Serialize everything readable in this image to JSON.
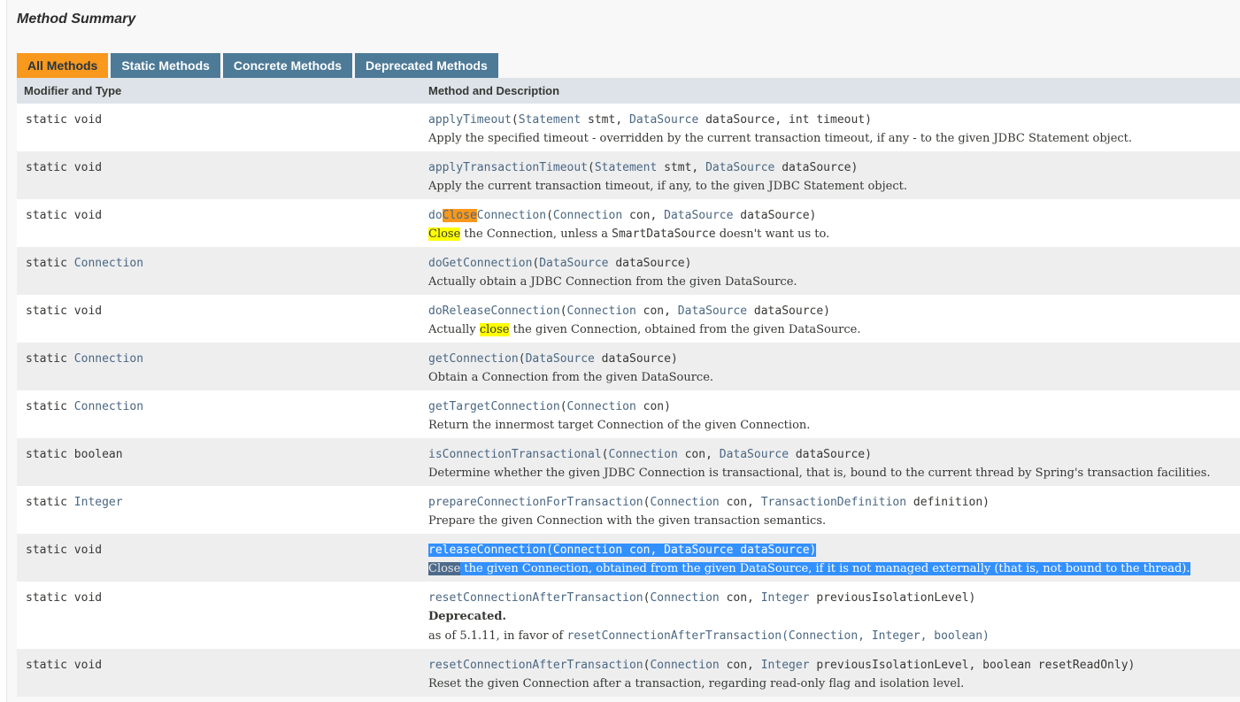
{
  "title": "Method Summary",
  "tabs": [
    "All Methods",
    "Static Methods",
    "Concrete Methods",
    "Deprecated Methods"
  ],
  "header": {
    "col1": "Modifier and Type",
    "col2": "Method and Description"
  },
  "rows": [
    {
      "mod": [
        [
          "static void",
          "p"
        ]
      ],
      "sig": [
        [
          "applyTimeout",
          "l"
        ],
        [
          "(",
          "p"
        ],
        [
          "Statement",
          "l"
        ],
        [
          " stmt, ",
          "p"
        ],
        [
          "DataSource",
          "l"
        ],
        [
          " dataSource, int timeout)",
          "p"
        ]
      ],
      "desc": [
        [
          "Apply the specified timeout - overridden by the current transaction timeout, if any - to the given JDBC Statement object.",
          "p"
        ]
      ]
    },
    {
      "mod": [
        [
          "static void",
          "p"
        ]
      ],
      "sig": [
        [
          "applyTransactionTimeout",
          "l"
        ],
        [
          "(",
          "p"
        ],
        [
          "Statement",
          "l"
        ],
        [
          " stmt, ",
          "p"
        ],
        [
          "DataSource",
          "l"
        ],
        [
          " dataSource)",
          "p"
        ]
      ],
      "desc": [
        [
          "Apply the current transaction timeout, if any, to the given JDBC Statement object.",
          "p"
        ]
      ]
    },
    {
      "mod": [
        [
          "static void",
          "p"
        ]
      ],
      "sig": [
        [
          "do",
          "l"
        ],
        [
          "Close",
          "o"
        ],
        [
          "Connection",
          "l"
        ],
        [
          "(",
          "p"
        ],
        [
          "Connection",
          "l"
        ],
        [
          " con, ",
          "p"
        ],
        [
          "DataSource",
          "l"
        ],
        [
          " dataSource)",
          "p"
        ]
      ],
      "desc": [
        [
          "Close",
          "y"
        ],
        [
          " the Connection, unless a ",
          "p"
        ],
        [
          "SmartDataSource",
          "m"
        ],
        [
          " doesn't want us to.",
          "p"
        ]
      ]
    },
    {
      "mod": [
        [
          "static ",
          "p"
        ],
        [
          "Connection",
          "l"
        ]
      ],
      "sig": [
        [
          "doGetConnection",
          "l"
        ],
        [
          "(",
          "p"
        ],
        [
          "DataSource",
          "l"
        ],
        [
          " dataSource)",
          "p"
        ]
      ],
      "desc": [
        [
          "Actually obtain a JDBC Connection from the given DataSource.",
          "p"
        ]
      ]
    },
    {
      "mod": [
        [
          "static void",
          "p"
        ]
      ],
      "sig": [
        [
          "doReleaseConnection",
          "l"
        ],
        [
          "(",
          "p"
        ],
        [
          "Connection",
          "l"
        ],
        [
          " con, ",
          "p"
        ],
        [
          "DataSource",
          "l"
        ],
        [
          " dataSource)",
          "p"
        ]
      ],
      "desc": [
        [
          "Actually ",
          "p"
        ],
        [
          "close",
          "y"
        ],
        [
          " the given Connection, obtained from the given DataSource.",
          "p"
        ]
      ]
    },
    {
      "mod": [
        [
          "static ",
          "p"
        ],
        [
          "Connection",
          "l"
        ]
      ],
      "sig": [
        [
          "getConnection",
          "l"
        ],
        [
          "(",
          "p"
        ],
        [
          "DataSource",
          "l"
        ],
        [
          " dataSource)",
          "p"
        ]
      ],
      "desc": [
        [
          "Obtain a Connection from the given DataSource.",
          "p"
        ]
      ]
    },
    {
      "mod": [
        [
          "static ",
          "p"
        ],
        [
          "Connection",
          "l"
        ]
      ],
      "sig": [
        [
          "getTargetConnection",
          "l"
        ],
        [
          "(",
          "p"
        ],
        [
          "Connection",
          "l"
        ],
        [
          " con)",
          "p"
        ]
      ],
      "desc": [
        [
          "Return the innermost target Connection of the given Connection.",
          "p"
        ]
      ]
    },
    {
      "mod": [
        [
          "static boolean",
          "p"
        ]
      ],
      "sig": [
        [
          "isConnectionTransactional",
          "l"
        ],
        [
          "(",
          "p"
        ],
        [
          "Connection",
          "l"
        ],
        [
          " con, ",
          "p"
        ],
        [
          "DataSource",
          "l"
        ],
        [
          " dataSource)",
          "p"
        ]
      ],
      "desc": [
        [
          "Determine whether the given JDBC Connection is transactional, that is, bound to the current thread by Spring's transaction facilities.",
          "p"
        ]
      ]
    },
    {
      "mod": [
        [
          "static ",
          "p"
        ],
        [
          "Integer",
          "l"
        ]
      ],
      "sig": [
        [
          "prepareConnectionForTransaction",
          "l"
        ],
        [
          "(",
          "p"
        ],
        [
          "Connection",
          "l"
        ],
        [
          " con, ",
          "p"
        ],
        [
          "TransactionDefinition",
          "l"
        ],
        [
          " definition)",
          "p"
        ]
      ],
      "desc": [
        [
          "Prepare the given Connection with the given transaction semantics.",
          "p"
        ]
      ]
    },
    {
      "selected": true,
      "mod": [
        [
          "static void",
          "p"
        ]
      ],
      "sig": [
        [
          "releaseConnection",
          "l"
        ],
        [
          "(",
          "p"
        ],
        [
          "Connection",
          "l"
        ],
        [
          " con, ",
          "p"
        ],
        [
          "DataSource",
          "l"
        ],
        [
          " dataSource) ",
          "p"
        ]
      ],
      "desc": [
        [
          "Close",
          "d"
        ],
        [
          " the given Connection, obtained from the given DataSource, if it is not managed externally (that is, not bound to the thread).",
          "p"
        ]
      ]
    },
    {
      "tall": true,
      "mod": [
        [
          "static void",
          "p"
        ]
      ],
      "sig": [
        [
          "resetConnectionAfterTransaction",
          "l"
        ],
        [
          "(",
          "p"
        ],
        [
          "Connection",
          "l"
        ],
        [
          " con, ",
          "p"
        ],
        [
          "Integer",
          "l"
        ],
        [
          " previousIsolationLevel)",
          "p"
        ]
      ],
      "deprecated": "Deprecated.",
      "desc": [
        [
          "as of 5.1.11, in favor of ",
          "p"
        ],
        [
          "resetConnectionAfterTransaction(Connection, Integer, boolean)",
          "ml"
        ]
      ]
    },
    {
      "mod": [
        [
          "static void",
          "p"
        ]
      ],
      "sig": [
        [
          "resetConnectionAfterTransaction",
          "l"
        ],
        [
          "(",
          "p"
        ],
        [
          "Connection",
          "l"
        ],
        [
          " con, ",
          "p"
        ],
        [
          "Integer",
          "l"
        ],
        [
          " previousIsolationLevel, boolean resetReadOnly)",
          "p"
        ]
      ],
      "desc": [
        [
          "Reset the given Connection after a transaction, regarding read-only flag and isolation level.",
          "p"
        ]
      ]
    }
  ]
}
